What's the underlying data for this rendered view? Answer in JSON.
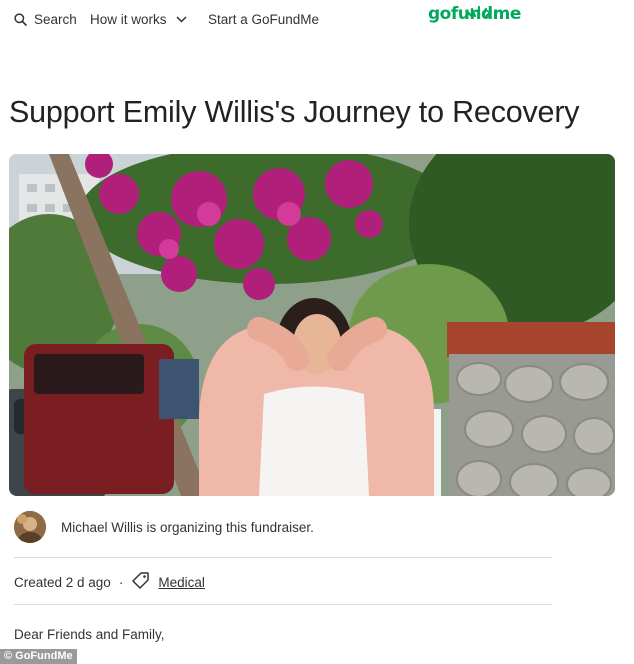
{
  "nav": {
    "search_label": "Search",
    "how_label": "How it works",
    "start_label": "Start a GoFundMe",
    "logo_text": "gofundme"
  },
  "campaign": {
    "title": "Support Emily Willis's Journey to Recovery",
    "organizer_text": "Michael Willis is organizing this fundraiser.",
    "created_text": "Created 2 d ago",
    "separator": "·",
    "category": "Medical",
    "body_start": "Dear Friends and Family,"
  },
  "credit": "© GoFundMe",
  "colors": {
    "brand": "#02a95c",
    "text": "#333333",
    "divider": "#d9d9d9"
  },
  "icons": [
    "search-icon",
    "chevron-down-icon",
    "logo-sprout-icon",
    "tag-icon"
  ]
}
